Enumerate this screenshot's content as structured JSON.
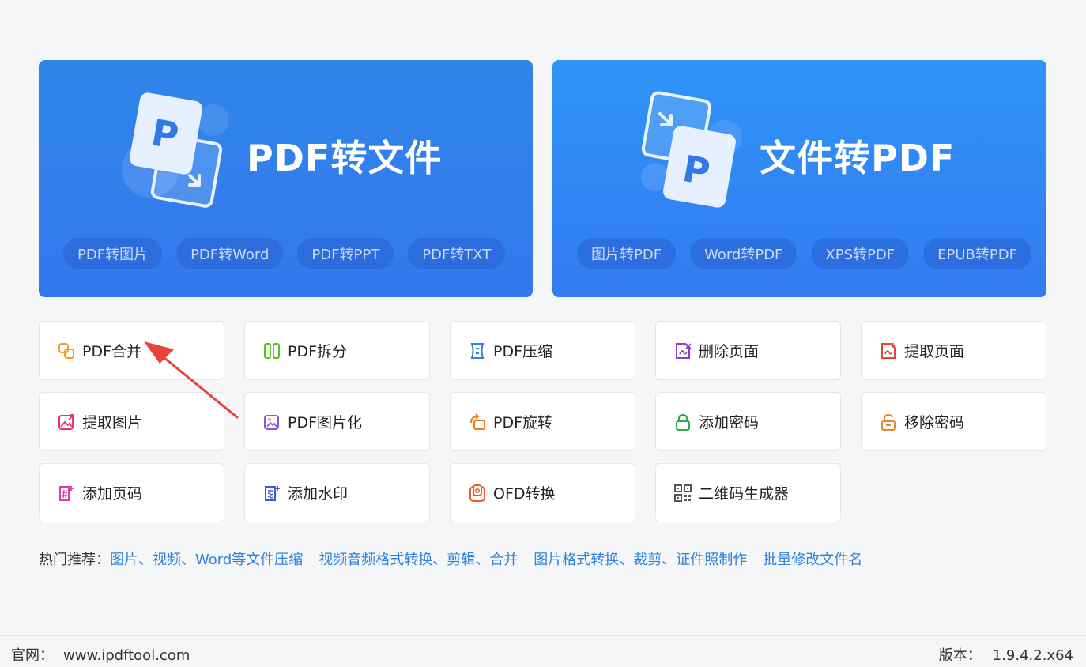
{
  "banners": {
    "pdf_to_file": {
      "title": "PDF转文件",
      "chips": [
        "PDF转图片",
        "PDF转Word",
        "PDF转PPT",
        "PDF转TXT"
      ]
    },
    "file_to_pdf": {
      "title": "文件转PDF",
      "chips": [
        "图片转PDF",
        "Word转PDF",
        "XPS转PDF",
        "EPUB转PDF"
      ]
    }
  },
  "tools": [
    {
      "label": "PDF合并",
      "icon": "merge-icon",
      "color": "#f0a020"
    },
    {
      "label": "PDF拆分",
      "icon": "split-icon",
      "color": "#52c41a"
    },
    {
      "label": "PDF压缩",
      "icon": "compress-icon",
      "color": "#2f7fe0"
    },
    {
      "label": "删除页面",
      "icon": "delete-page-icon",
      "color": "#8a3fd1"
    },
    {
      "label": "提取页面",
      "icon": "extract-page-icon",
      "color": "#e0453a"
    },
    {
      "label": "提取图片",
      "icon": "extract-image-icon",
      "color": "#e8336d"
    },
    {
      "label": "PDF图片化",
      "icon": "pdf-to-image-icon",
      "color": "#8a5ad8"
    },
    {
      "label": "PDF旋转",
      "icon": "rotate-icon",
      "color": "#f07a20"
    },
    {
      "label": "添加密码",
      "icon": "lock-icon",
      "color": "#2fa84f"
    },
    {
      "label": "移除密码",
      "icon": "unlock-icon",
      "color": "#e08a30"
    },
    {
      "label": "添加页码",
      "icon": "page-number-icon",
      "color": "#e03ca0"
    },
    {
      "label": "添加水印",
      "icon": "watermark-icon",
      "color": "#3a5ad8"
    },
    {
      "label": "OFD转换",
      "icon": "ofd-icon",
      "color": "#f05a20"
    },
    {
      "label": "二维码生成器",
      "icon": "qrcode-icon",
      "color": "#555555"
    }
  ],
  "hot": {
    "label": "热门推荐：",
    "links": [
      "图片、视频、Word等文件压缩",
      "视频音频格式转换、剪辑、合并",
      "图片格式转换、裁剪、证件照制作",
      "批量修改文件名"
    ]
  },
  "footer": {
    "site_label": "官网：",
    "site_url": "www.ipdftool.com",
    "version_label": "版本：",
    "version": "1.9.4.2.x64"
  }
}
